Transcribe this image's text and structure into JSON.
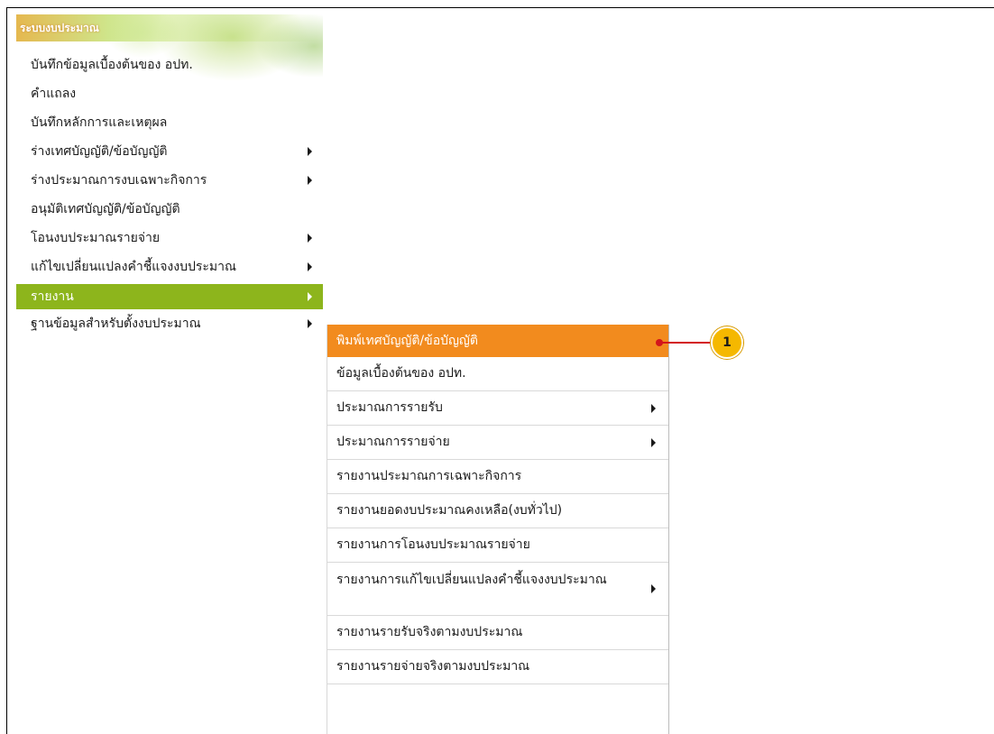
{
  "menu": {
    "banner_title": "ระบบงบประมาณ",
    "items": [
      {
        "label": "บันทึกข้อมูลเบื้องต้นของ อปท.",
        "has_submenu": false
      },
      {
        "label": "คำแถลง",
        "has_submenu": false
      },
      {
        "label": "บันทึกหลักการและเหตุผล",
        "has_submenu": false
      },
      {
        "label": "ร่างเทศบัญญัติ/ข้อบัญญัติ",
        "has_submenu": true
      },
      {
        "label": "ร่างประมาณการงบเฉพาะกิจการ",
        "has_submenu": true
      },
      {
        "label": "อนุมัติเทศบัญญัติ/ข้อบัญญัติ",
        "has_submenu": false
      },
      {
        "label": "โอนงบประมาณรายจ่าย",
        "has_submenu": true
      },
      {
        "label": "แก้ไขเปลี่ยนแปลงคำชี้แจงงบประมาณ",
        "has_submenu": true
      },
      {
        "label": "รายงาน",
        "has_submenu": true,
        "active": true
      },
      {
        "label": "ฐานข้อมูลสำหรับตั้งงบประมาณ",
        "has_submenu": true
      }
    ]
  },
  "submenu": {
    "items": [
      {
        "label": "พิมพ์เทศบัญญัติ/ข้อบัญญัติ",
        "highlight": true
      },
      {
        "label": "ข้อมูลเบื้องต้นของ อปท."
      },
      {
        "label": "ประมาณการรายรับ",
        "has_submenu": true
      },
      {
        "label": "ประมาณการรายจ่าย",
        "has_submenu": true
      },
      {
        "label": "รายงานประมาณการเฉพาะกิจการ"
      },
      {
        "label": "รายงานยอดงบประมาณคงเหลือ(งบทั่วไป)"
      },
      {
        "label": "รายงานการโอนงบประมาณรายจ่าย"
      },
      {
        "label": "รายงานการแก้ไขเปลี่ยนแปลงคำชี้แจงงบประมาณ",
        "has_submenu": true
      },
      {
        "label": "รายงานรายรับจริงตามงบประมาณ"
      },
      {
        "label": "รายงานรายจ่ายจริงตามงบประมาณ"
      }
    ]
  },
  "callout": {
    "number": "1"
  },
  "colors": {
    "active_menu_bg": "#8db51c",
    "highlight_submenu_bg": "#f28b1e",
    "callout_badge": "#f5b800",
    "callout_line": "#d3161b"
  }
}
